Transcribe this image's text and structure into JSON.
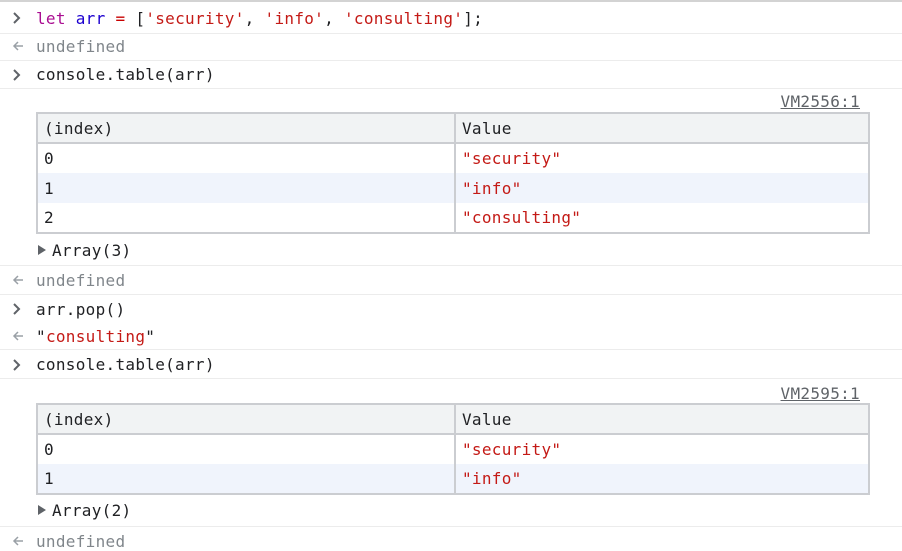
{
  "console": {
    "cmd1": {
      "kw": "let",
      "var": "arr",
      "op": "=",
      "open": "[",
      "s1": "'security'",
      "s2": "'info'",
      "s3": "'consulting'",
      "close": "];",
      "comma": ","
    },
    "res1": "undefined",
    "cmd2": "console.table(arr)",
    "table1": {
      "source": "VM2556:1",
      "headers": [
        "(index)",
        "Value"
      ],
      "rows": [
        {
          "index": "0",
          "value": "\"security\""
        },
        {
          "index": "1",
          "value": "\"info\""
        },
        {
          "index": "2",
          "value": "\"consulting\""
        }
      ],
      "summary": "Array(3)"
    },
    "res2": "undefined",
    "cmd3": "arr.pop()",
    "res3": {
      "q1": "\"",
      "val": "consulting",
      "q2": "\""
    },
    "cmd4": "console.table(arr)",
    "table2": {
      "source": "VM2595:1",
      "headers": [
        "(index)",
        "Value"
      ],
      "rows": [
        {
          "index": "0",
          "value": "\"security\""
        },
        {
          "index": "1",
          "value": "\"info\""
        }
      ],
      "summary": "Array(2)"
    },
    "res4": "undefined"
  },
  "icons": {
    "input": "chevron-right-icon",
    "output": "return-arrow-icon",
    "expand": "triangle-right-icon"
  }
}
